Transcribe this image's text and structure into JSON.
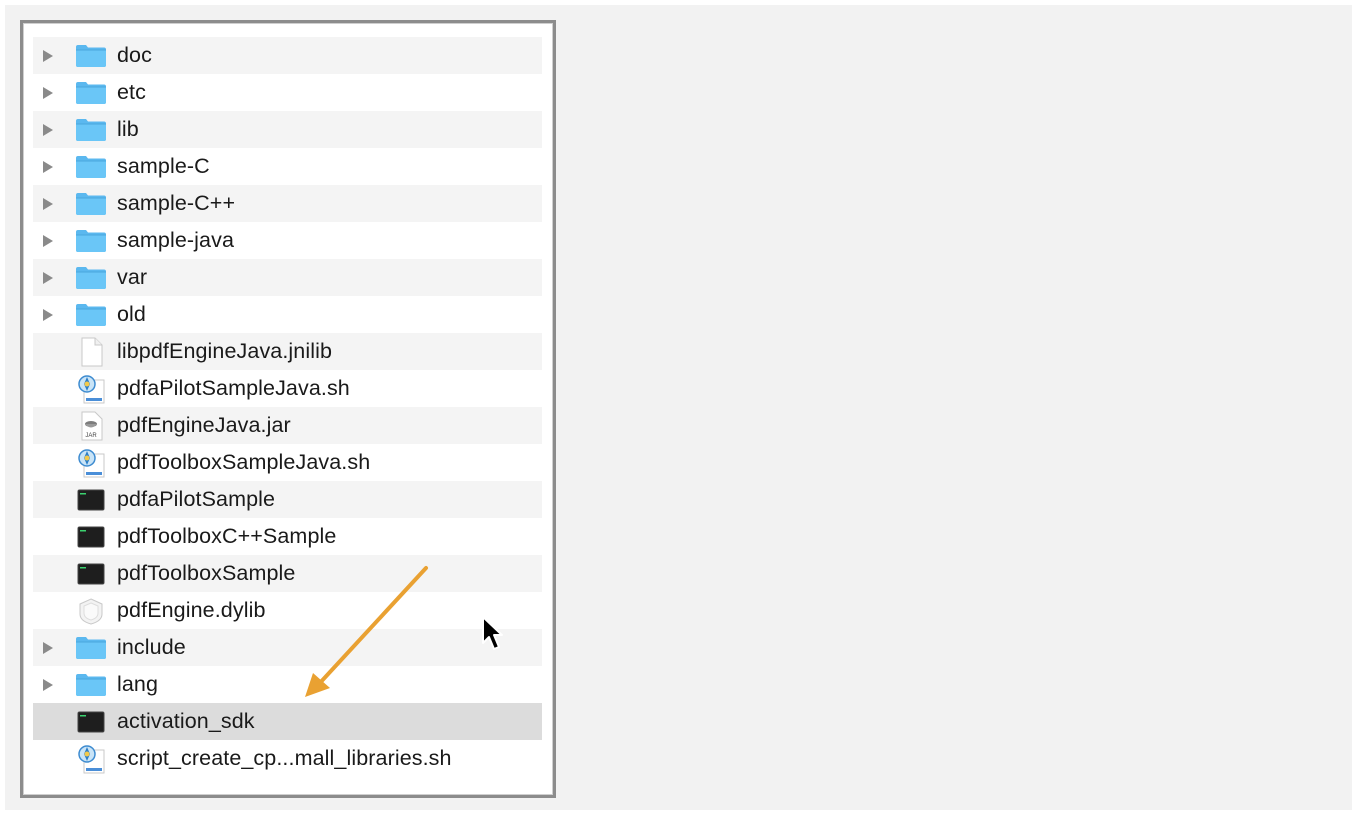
{
  "files": [
    {
      "name": "doc",
      "kind": "folder",
      "expandable": true
    },
    {
      "name": "etc",
      "kind": "folder",
      "expandable": true
    },
    {
      "name": "lib",
      "kind": "folder",
      "expandable": true
    },
    {
      "name": "sample-C",
      "kind": "folder",
      "expandable": true
    },
    {
      "name": "sample-C++",
      "kind": "folder",
      "expandable": true
    },
    {
      "name": "sample-java",
      "kind": "folder",
      "expandable": true
    },
    {
      "name": "var",
      "kind": "folder",
      "expandable": true
    },
    {
      "name": "old",
      "kind": "folder",
      "expandable": true
    },
    {
      "name": "libpdfEngineJava.jnilib",
      "kind": "document",
      "expandable": false
    },
    {
      "name": "pdfaPilotSampleJava.sh",
      "kind": "script",
      "expandable": false
    },
    {
      "name": "pdfEngineJava.jar",
      "kind": "jar",
      "expandable": false
    },
    {
      "name": "pdfToolboxSampleJava.sh",
      "kind": "script",
      "expandable": false
    },
    {
      "name": "pdfaPilotSample",
      "kind": "executable",
      "expandable": false
    },
    {
      "name": "pdfToolboxC++Sample",
      "kind": "executable",
      "expandable": false
    },
    {
      "name": "pdfToolboxSample",
      "kind": "executable",
      "expandable": false
    },
    {
      "name": "pdfEngine.dylib",
      "kind": "library",
      "expandable": false
    },
    {
      "name": "include",
      "kind": "folder",
      "expandable": true
    },
    {
      "name": "lang",
      "kind": "folder",
      "expandable": true
    },
    {
      "name": "activation_sdk",
      "kind": "executable",
      "expandable": false,
      "selected": true
    },
    {
      "name": "script_create_cp...mall_libraries.sh",
      "kind": "script",
      "expandable": false
    }
  ],
  "icons": {
    "folder": "folder-icon",
    "document": "document-icon",
    "script": "shell-script-icon",
    "jar": "jar-icon",
    "executable": "terminal-executable-icon",
    "library": "dylib-icon"
  },
  "colors": {
    "annotation_arrow": "#e9a132",
    "folder": "#5bb8ef",
    "selection": "#dcdcdc"
  }
}
